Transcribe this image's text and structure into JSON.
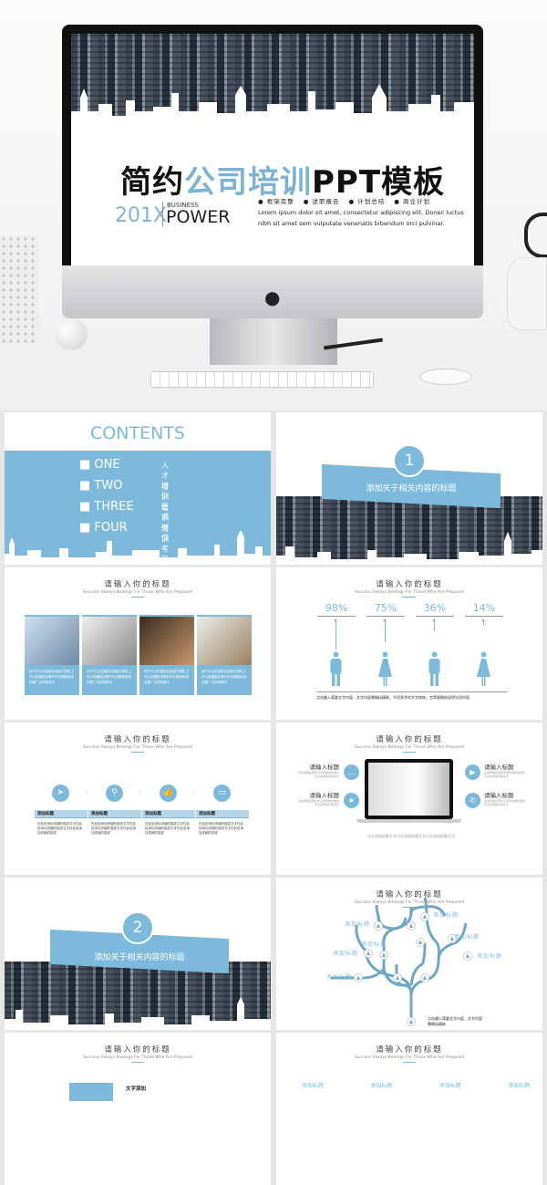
{
  "hero": {
    "title_part1": "简约",
    "title_highlight": "公司培训",
    "title_part2": "PPT模板",
    "year": "201X",
    "business": "BUSINESS",
    "power": "POWER",
    "bullets": [
      "● 框架完整",
      "● 述职报告",
      "● 计划总结",
      "● 商业计划"
    ],
    "lorem": "Lorem ipsum dolor sit amet, consectetur adipiscing elit. Donec luctus nibh sit amet sem vulputate venenatis bibendum orci pulvinar."
  },
  "common": {
    "slide_title": "请输入你的标题",
    "slide_subtitle": "Success Always Belongs For Those Who Are Prepared"
  },
  "contents": {
    "heading": "CONTENTS",
    "items": [
      {
        "en": "ONE",
        "cn": "人才培训"
      },
      {
        "en": "TWO",
        "cn": "培训要求"
      },
      {
        "en": "THREE",
        "cn": "培训岗位"
      },
      {
        "en": "FOUR",
        "cn": "培训考核"
      }
    ]
  },
  "section1": {
    "number": "1",
    "title": "添加关于相关内容的标题"
  },
  "section2": {
    "number": "2",
    "title": "添加关于相关内容的标题"
  },
  "photos": {
    "caption": "用户可以在投影仪或者计算机上可以用播放文稿打印文稿使用用到更广泛的领域中"
  },
  "people": {
    "percents": [
      "98%",
      "75%",
      "36%",
      "14%"
    ],
    "values": [
      98,
      75,
      36,
      14
    ],
    "icons": [
      "man-icon",
      "woman-icon",
      "man-icon",
      "woman-icon"
    ],
    "note": "点击输入简要文字内容，文字内容需概括精炼，不用多余的文字修饰，言简意赅的说明分项内容"
  },
  "process": {
    "icons": [
      "paper-plane-icon",
      "search-icon",
      "thumbs-up-icon",
      "monitor-icon"
    ],
    "labels": [
      "添加标题",
      "添加标题",
      "添加标题",
      "添加标题"
    ],
    "body": "在此处添加详细的描述文字在此处添加详细的描述文字在此处添加详细的描述"
  },
  "laptop": {
    "items": [
      "请输入标题",
      "请输入标题",
      "请输入标题",
      "请输入标题"
    ],
    "icons": [
      "chat-icon",
      "star-icon",
      "play-icon",
      "phone-icon"
    ],
    "body": "点击添加标题文字点击添加标题文字点击添加标题文字"
  },
  "tree": {
    "labels": [
      "添加标题",
      "添加标题",
      "添加标题",
      "添加标题",
      "添加标题",
      "添加标题",
      "添加标题"
    ],
    "note": "点击输入简要文字内容，文字内容需概括精炼"
  },
  "slide9": {
    "heading": "文字添加"
  },
  "slide10": {
    "labels": [
      "添加标题",
      "添加标题",
      "添加标题",
      "添加标题"
    ]
  },
  "colors": {
    "accent": "#7db9da",
    "dark": "#111111"
  }
}
